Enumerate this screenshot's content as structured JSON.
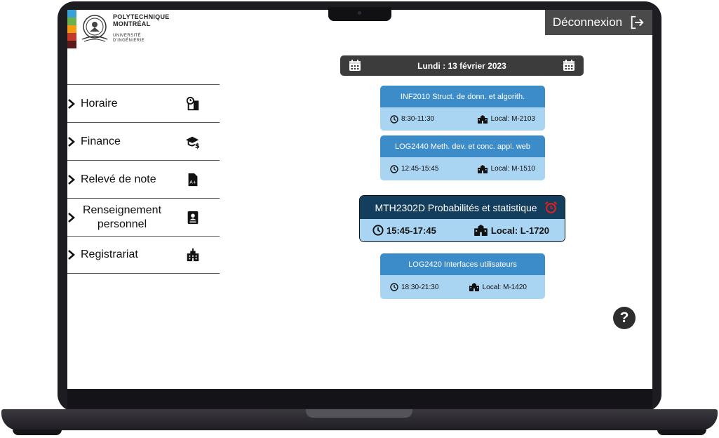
{
  "logo": {
    "line1": "POLYTECHNIQUE",
    "line2": "MONTRÉAL",
    "line3": "UNIVERSITÉ",
    "line4": "D'INGÉNIERIE",
    "stripe_colors": [
      "#3aa0d8",
      "#6ab04c",
      "#f39c12",
      "#c0392b",
      "#5a1a1a"
    ]
  },
  "header": {
    "logout_label": "Déconnexion",
    "logout_icon": "logout-icon"
  },
  "sidebar": {
    "items": [
      {
        "label": "Horaire",
        "icon": "schedule-clock-icon"
      },
      {
        "label": "Finance",
        "icon": "graduation-cap-dollar-icon"
      },
      {
        "label": "Relevé de note",
        "icon": "grade-document-icon"
      },
      {
        "label": "Renseignement personnel",
        "icon": "id-card-icon"
      },
      {
        "label": "Registrariat",
        "icon": "building-icon"
      }
    ]
  },
  "schedule": {
    "date_label": "Lundi : 13 février 2023",
    "courses": [
      {
        "title": "INF2010 Struct. de donn. et algorith.",
        "time": "8:30-11:30",
        "room": "Local: M-2103",
        "current": false
      },
      {
        "title": "LOG2440 Meth. dev. et conc. appl. web",
        "time": "12:45-15:45",
        "room": "Local: M-1510",
        "current": false
      },
      {
        "title": "MTH2302D Probabilités et statistique",
        "time": "15:45-17:45",
        "room": "Local: L-1720",
        "current": true,
        "alert_icon": "alarm-clock-icon",
        "alert_color": "#e02020"
      },
      {
        "title": "LOG2420 Interfaces utilisateurs",
        "time": "18:30-21:30",
        "room": "Local: M-1420",
        "current": false
      }
    ]
  },
  "help": {
    "label": "?"
  },
  "colors": {
    "card_header": "#3c8cc9",
    "card_body": "#a9d4f2",
    "current_header": "#143e5e",
    "date_bar": "#3c3c3c",
    "logout_bg": "#4a4a4a"
  }
}
